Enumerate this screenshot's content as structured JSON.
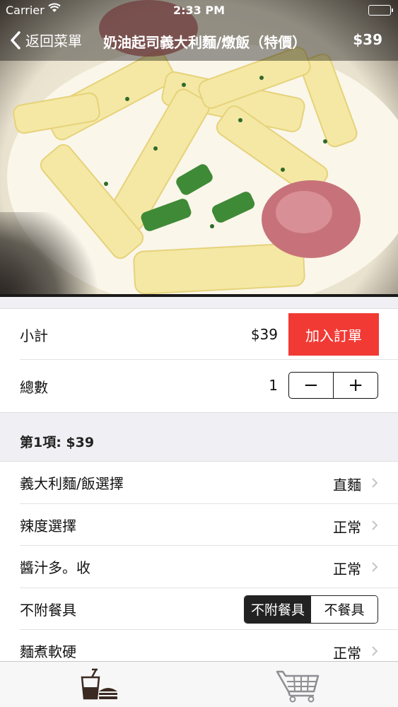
{
  "status_bar": {
    "carrier": "Carrier",
    "time": "2:33 PM"
  },
  "nav": {
    "back_label": "返回菜單",
    "title": "奶油起司義大利麵/燉飯（特價）",
    "price": "$39"
  },
  "summary": {
    "subtotal_label": "小計",
    "subtotal_value": "$39",
    "add_button": "加入訂單",
    "qty_label": "總數",
    "qty_value": "1",
    "minus": "−",
    "plus": "+"
  },
  "section": {
    "header": "第1項: $39"
  },
  "options": [
    {
      "label": "義大利麵/飯選擇",
      "value": "直麵"
    },
    {
      "label": "辣度選擇",
      "value": "正常"
    },
    {
      "label": "醬汁多。收",
      "value": "正常"
    },
    {
      "label": "不附餐具"
    },
    {
      "label": "麵煮軟硬",
      "value": "正常"
    }
  ],
  "utensils_segment": {
    "options": [
      "不附餐具",
      "不餐具"
    ],
    "selected": "不附餐具"
  },
  "tab_bar": {
    "items": [
      {
        "icon": "drink-burger-icon"
      },
      {
        "icon": "cart-icon"
      }
    ]
  },
  "colors": {
    "accent": "#f23a35",
    "bar_bg": "#f7f7f7",
    "section_bg": "#efeff4"
  }
}
